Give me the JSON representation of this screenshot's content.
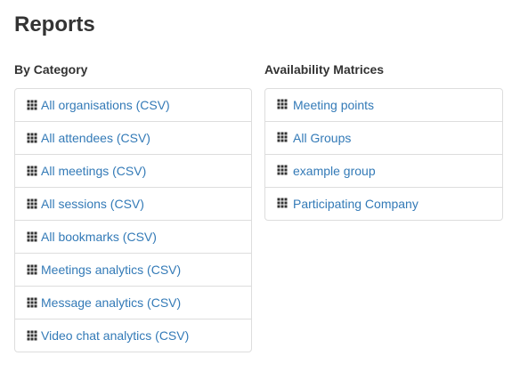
{
  "page": {
    "title": "Reports"
  },
  "by_category": {
    "heading": "By Category",
    "items": [
      {
        "label": "All organisations (CSV)",
        "icon": "grid-icon"
      },
      {
        "label": "All attendees (CSV)",
        "icon": "grid-icon"
      },
      {
        "label": "All meetings (CSV)",
        "icon": "grid-icon"
      },
      {
        "label": "All sessions (CSV)",
        "icon": "grid-icon"
      },
      {
        "label": "All bookmarks (CSV)",
        "icon": "grid-icon"
      },
      {
        "label": "Meetings analytics (CSV)",
        "icon": "grid-icon"
      },
      {
        "label": "Message analytics (CSV)",
        "icon": "grid-icon"
      },
      {
        "label": "Video chat analytics (CSV)",
        "icon": "grid-icon"
      }
    ]
  },
  "availability_matrices": {
    "heading": "Availability Matrices",
    "items": [
      {
        "label": "Meeting points",
        "icon": "grid-icon"
      },
      {
        "label": "All Groups",
        "icon": "grid-icon"
      },
      {
        "label": "example group",
        "icon": "grid-icon"
      },
      {
        "label": "Participating Company",
        "icon": "grid-icon"
      }
    ]
  },
  "colors": {
    "text": "#333333",
    "link": "#337ab7",
    "border": "#dddddd",
    "icon": "#333333"
  }
}
